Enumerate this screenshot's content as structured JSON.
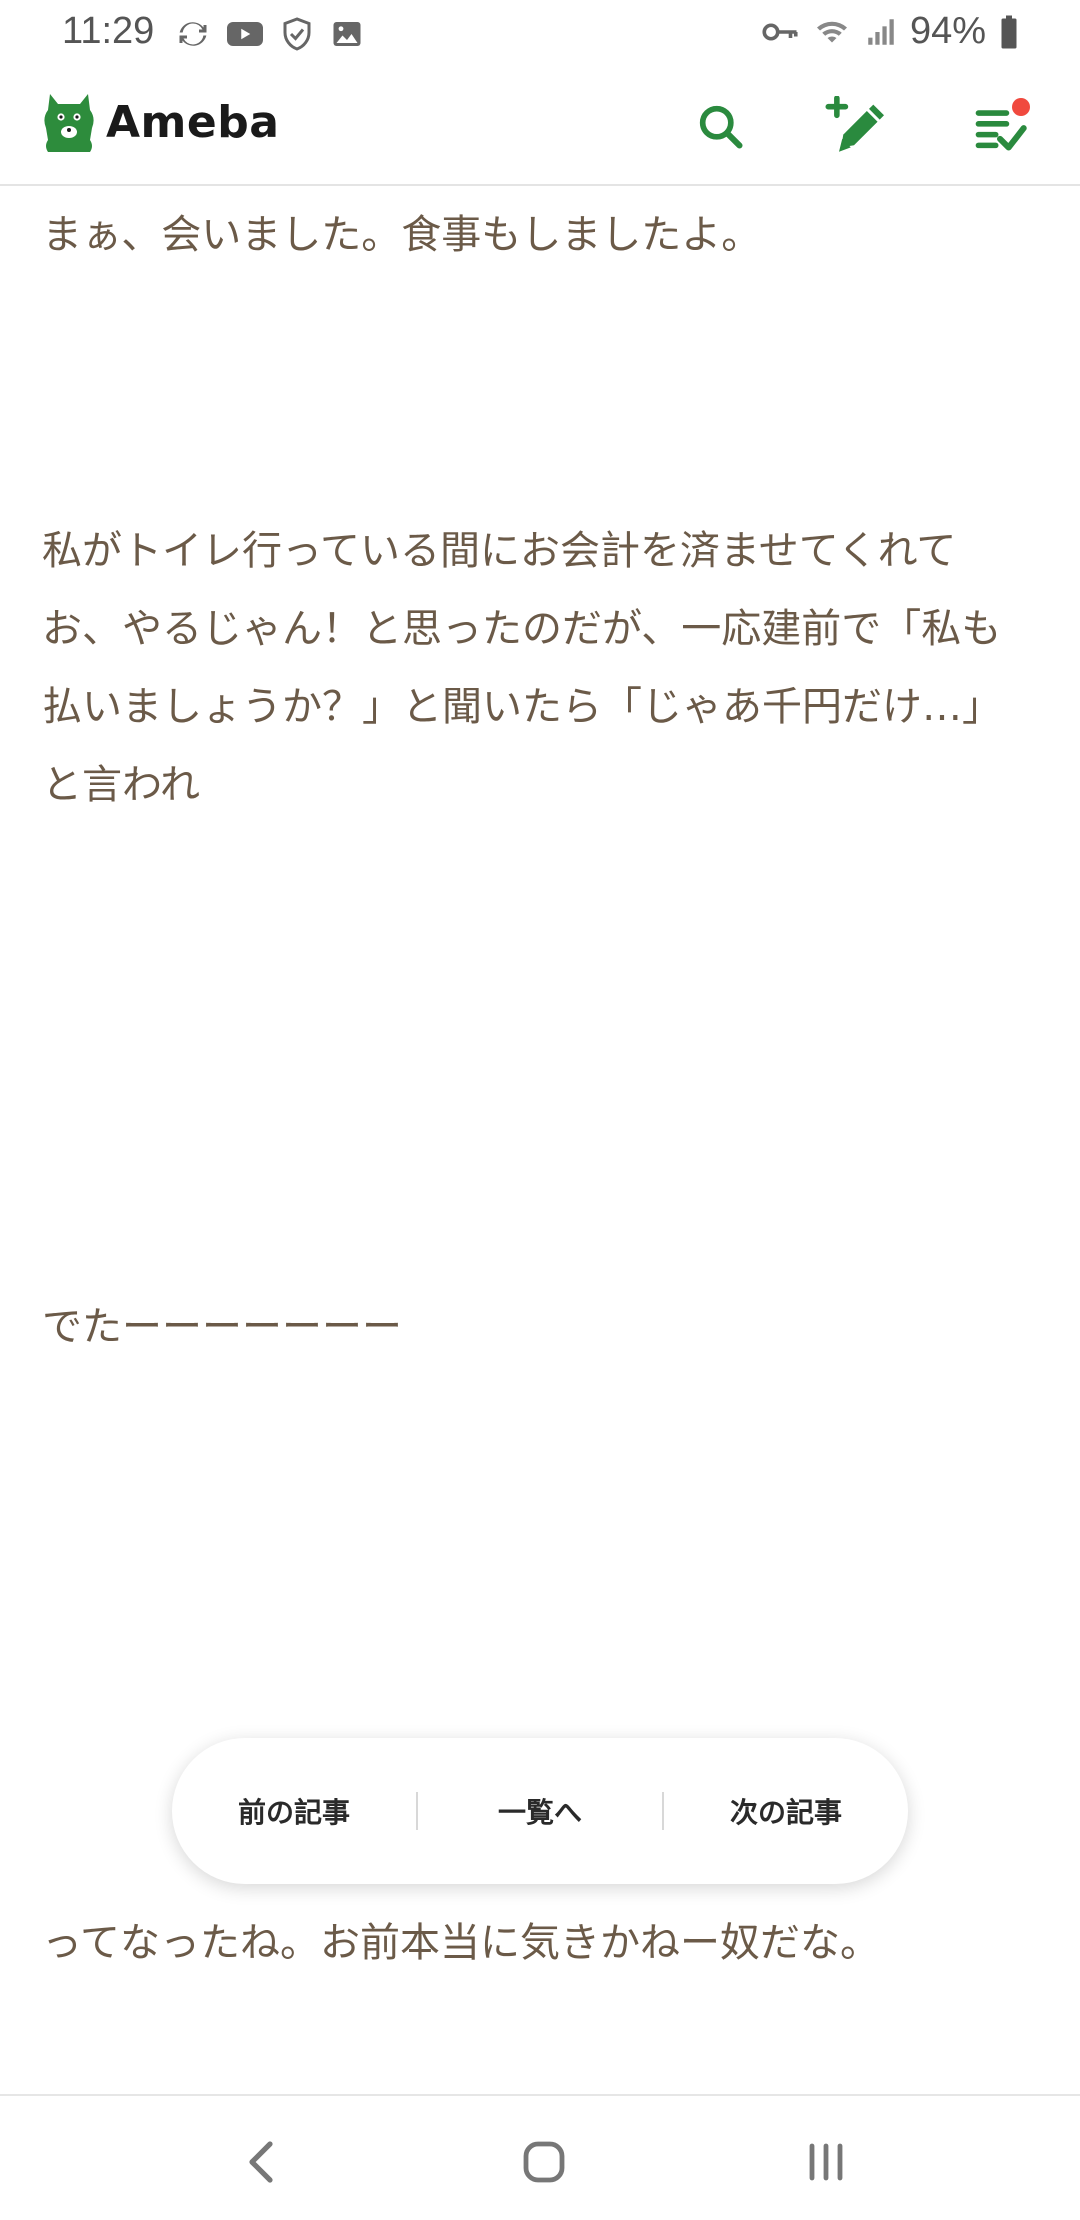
{
  "status_bar": {
    "time": "11:29",
    "battery_percent": "94%",
    "left_icons": [
      "sync-icon",
      "youtube-icon",
      "shield-check-icon",
      "gallery-icon"
    ],
    "right_icons": [
      "vpn-key-icon",
      "wifi-icon",
      "signal-icon",
      "battery-icon"
    ]
  },
  "header": {
    "brand_name": "Ameba",
    "icons": [
      "search-icon",
      "write-post-icon",
      "feed-list-icon"
    ],
    "accent_color": "#2a8a3e",
    "notification_dot_color": "#f0493e"
  },
  "article": {
    "text_color": "#6b5a48",
    "paragraphs": [
      "まぁ、会いました。食事もしましたよ。",
      "私がトイレ行っている間にお会計を済ませてくれてお、やるじゃん！と思ったのだが、一応建前で「私も払いましょうか？」と聞いたら「じゃあ千円だけ…」と言われ",
      "でたーーーーーーー",
      "ってなったね。お前本当に気きかねー奴だな。"
    ]
  },
  "article_nav": {
    "prev_label": "前の記事",
    "list_label": "一覧へ",
    "next_label": "次の記事"
  },
  "system_nav": {
    "icons": [
      "back-icon",
      "home-icon",
      "recents-icon"
    ]
  }
}
